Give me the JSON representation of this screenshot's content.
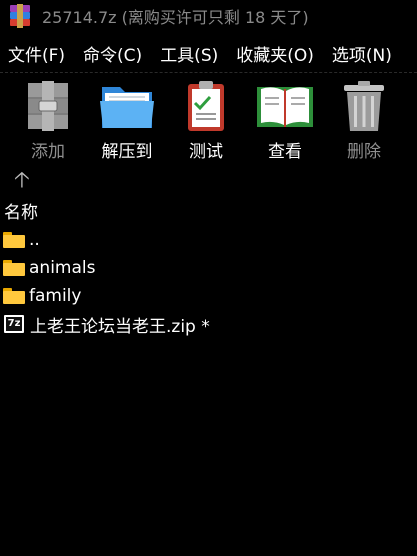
{
  "window": {
    "title": "25714.7z (离购买许可只剩 18 天了)"
  },
  "menu": [
    "文件(F)",
    "命令(C)",
    "工具(S)",
    "收藏夹(O)",
    "选项(N)"
  ],
  "toolbar": [
    {
      "label": "添加",
      "icon": "archive-add-icon",
      "enabled": false
    },
    {
      "label": "解压到",
      "icon": "extract-folder-icon",
      "enabled": true
    },
    {
      "label": "测试",
      "icon": "clipboard-check-icon",
      "enabled": true
    },
    {
      "label": "查看",
      "icon": "open-book-icon",
      "enabled": true
    },
    {
      "label": "删除",
      "icon": "trash-icon",
      "enabled": false
    }
  ],
  "list": {
    "column_name": "名称",
    "items": [
      {
        "name": "..",
        "type": "folder"
      },
      {
        "name": "animals",
        "type": "folder"
      },
      {
        "name": "family",
        "type": "folder"
      },
      {
        "name": "上老王论坛当老王.zip *",
        "type": "7z-archive"
      }
    ]
  },
  "colors": {
    "background": "#000000",
    "text": "#ffffff",
    "disabled_text": "#8f8f8f",
    "folder": "#ffc83d"
  }
}
